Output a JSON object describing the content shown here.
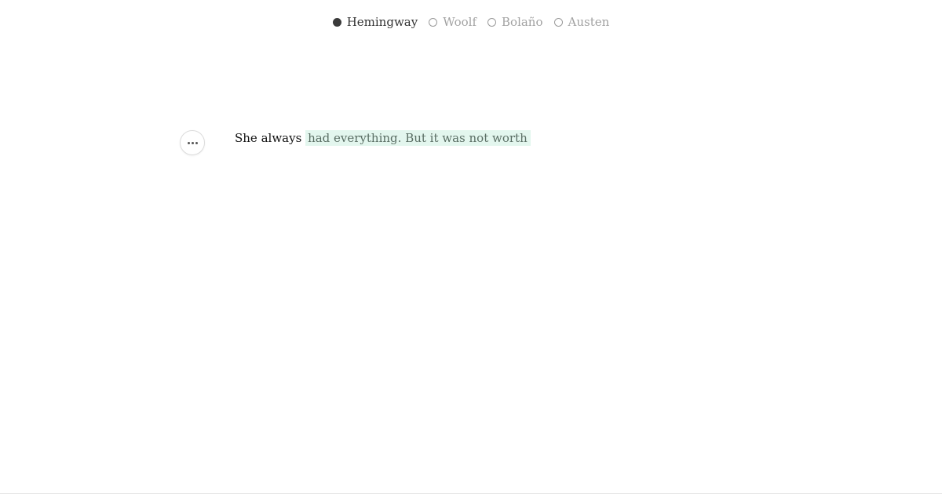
{
  "authors": [
    {
      "label": "Hemingway",
      "selected": true
    },
    {
      "label": "Woolf",
      "selected": false
    },
    {
      "label": "Bolaño",
      "selected": false
    },
    {
      "label": "Austen",
      "selected": false
    }
  ],
  "editor": {
    "typed_text": "She always",
    "suggestion_text": "had everything. But it was not worth"
  },
  "icons": {
    "more": "ellipsis-icon",
    "radio_selected": "radio-filled-icon",
    "radio_unselected": "radio-empty-icon"
  },
  "colors": {
    "suggestion_highlight": "#e3f6ee",
    "suggestion_text": "#5a6e64",
    "selected_author": "#333333",
    "unselected_author": "#a3a3a3"
  }
}
